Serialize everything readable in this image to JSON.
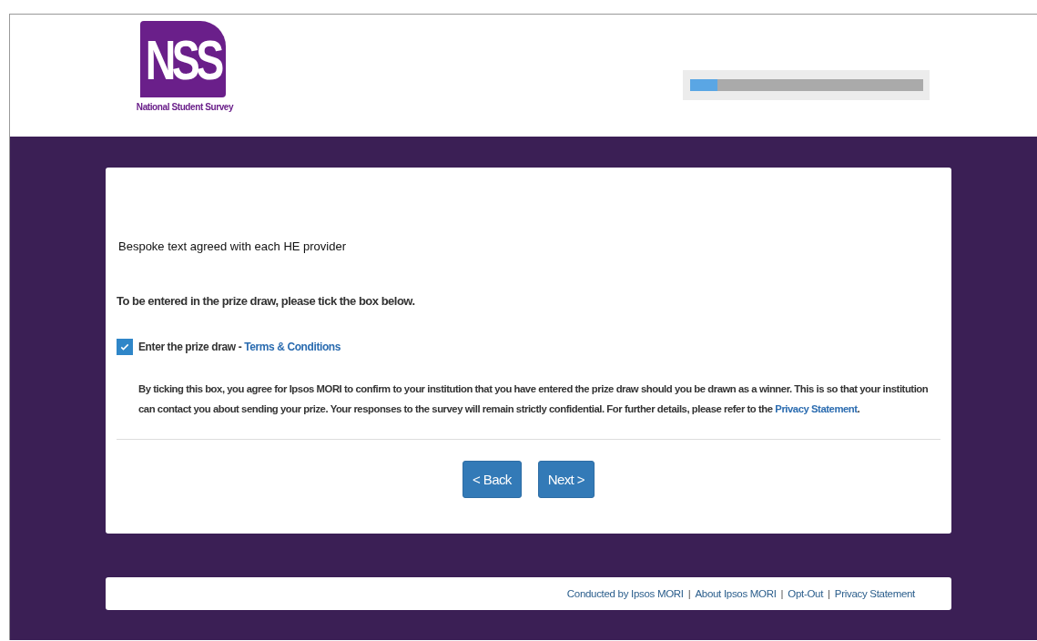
{
  "header": {
    "logo": {
      "letters": "NSS",
      "caption": "National Student Survey"
    },
    "progress": {
      "level": 0.12
    }
  },
  "card": {
    "intro": "Bespoke text agreed with each HE provider",
    "question": "To be entered in the prize draw, please tick the box below.",
    "checkbox": {
      "label": "Enter the prize draw - ",
      "link": "Terms & Conditions",
      "checked": true
    },
    "consent": {
      "text": "By ticking this box, you agree for Ipsos MORI to confirm to your institution that you have entered the prize draw should you be drawn as a winner. This is so that your institution can contact you about sending your prize. Your responses to the survey will remain strictly confidential. For further details, please refer to the ",
      "link": "Privacy Statement",
      "after": "."
    },
    "buttons": [
      {
        "label": "< Back"
      },
      {
        "label": "Next >"
      }
    ]
  },
  "footer": {
    "separator": "|",
    "links": [
      "Conducted by Ipsos MORI",
      "About Ipsos MORI",
      "Opt-Out",
      "Privacy Statement"
    ]
  }
}
